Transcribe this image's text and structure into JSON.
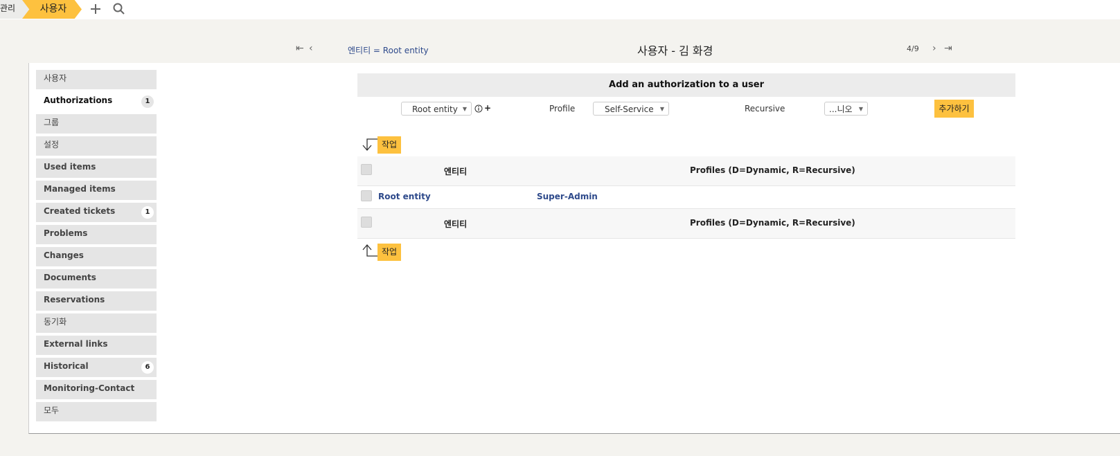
{
  "breadcrumb": {
    "prev": "관리",
    "current": "사용자"
  },
  "nav": {
    "entity_filter": "엔티티 = Root entity",
    "title": "사용자 - 김 화경",
    "page_count": "4/9"
  },
  "sidebar": {
    "items": [
      {
        "label": "사용자",
        "badge": ""
      },
      {
        "label": "Authorizations",
        "badge": "1"
      },
      {
        "label": "그룹",
        "badge": ""
      },
      {
        "label": "설정",
        "badge": ""
      },
      {
        "label": "Used items",
        "badge": ""
      },
      {
        "label": "Managed items",
        "badge": ""
      },
      {
        "label": "Created tickets",
        "badge": "1"
      },
      {
        "label": "Problems",
        "badge": ""
      },
      {
        "label": "Changes",
        "badge": ""
      },
      {
        "label": "Documents",
        "badge": ""
      },
      {
        "label": "Reservations",
        "badge": ""
      },
      {
        "label": "동기화",
        "badge": ""
      },
      {
        "label": "External links",
        "badge": ""
      },
      {
        "label": "Historical",
        "badge": "6"
      },
      {
        "label": "Monitoring-Contact",
        "badge": ""
      },
      {
        "label": "모두",
        "badge": ""
      }
    ]
  },
  "form": {
    "header": "Add an authorization to a user",
    "entity_value": "Root entity",
    "profile_label": "Profile",
    "profile_value": "Self-Service",
    "recursive_label": "Recursive",
    "recursive_value": "...니오",
    "add_button": "추가하기",
    "plus": "+"
  },
  "table": {
    "action_label": "작업",
    "col_entity": "엔티티",
    "col_profiles": "Profiles (D=Dynamic, R=Recursive)",
    "rows": [
      {
        "entity": "Root entity",
        "profile": "Super-Admin"
      }
    ]
  },
  "colors": {
    "accent": "#fdc13f",
    "link": "#2e4a8b"
  }
}
